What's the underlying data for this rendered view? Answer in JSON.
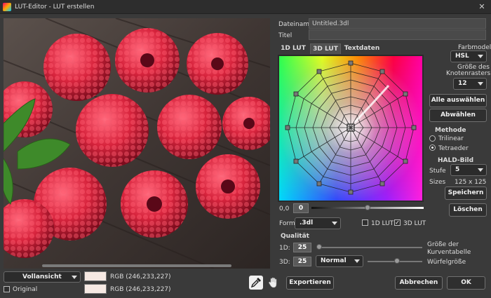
{
  "window": {
    "title": "LUT-Editor - LUT erstellen",
    "close": "✕"
  },
  "fields": {
    "filename_label": "Dateiname",
    "filename_value": "Untitled.3dl",
    "title_label": "Titel",
    "title_value": ""
  },
  "tabs": [
    {
      "label": "1D LUT"
    },
    {
      "label": "3D LUT"
    },
    {
      "label": "Textdaten"
    }
  ],
  "color_model": {
    "label": "Farbmodell",
    "value": "HSL"
  },
  "grid_size": {
    "label_line1": "Größe des",
    "label_line2": "Knotenrasters",
    "value": "12"
  },
  "buttons": {
    "select_all": "Alle auswählen",
    "deselect": "Abwählen",
    "save": "Speichern",
    "delete": "Löschen",
    "export": "Exportieren",
    "cancel": "Abbrechen",
    "ok": "OK"
  },
  "method": {
    "title": "Methode",
    "options": [
      "Trilinear",
      "Tetraeder"
    ],
    "selected": "Tetraeder"
  },
  "hald": {
    "title": "HALD-Bild",
    "level_label": "Stufe",
    "level_value": "5",
    "sizes_label": "Sizes",
    "sizes_value": "125 x 125"
  },
  "wheel_slider": {
    "min_label": "0,0",
    "value": "0"
  },
  "format": {
    "label": "Format",
    "value": ".3dl",
    "opt1": "1D LUT",
    "opt2": "3D LUT"
  },
  "quality": {
    "title": "Qualität",
    "d1_label": "1D:",
    "d1_value": "25",
    "d1_desc_line1": "Größe der",
    "d1_desc_line2": "Kurventabelle",
    "d3_label": "3D:",
    "d3_value": "25",
    "d3_mode": "Normal",
    "d3_desc": "Würfelgröße"
  },
  "bottom": {
    "view": "Vollansicht",
    "original_label": "Original",
    "rgb1": "RGB (246,233,227)",
    "rgb2": "RGB (246,233,227)",
    "swatch_color": "#f6e9e3"
  },
  "colors": {
    "berry": "#d8243d",
    "berry_dark": "#8a0f22",
    "wood": "#4a3f3a",
    "leaf": "#3e8a2a"
  }
}
